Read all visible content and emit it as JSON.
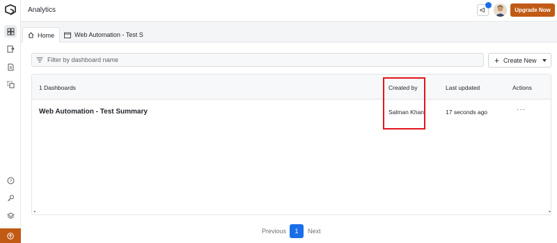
{
  "header": {
    "title": "Analytics",
    "upgrade_label": "Upgrade Now"
  },
  "tabs": [
    {
      "label": "Home",
      "icon": "home-icon",
      "active": true
    },
    {
      "label": "Web Automation - Test S",
      "icon": "calendar-icon",
      "active": false
    }
  ],
  "filter": {
    "placeholder": "Filter by dashboard name",
    "value": ""
  },
  "create_new": {
    "label": "Create New"
  },
  "table": {
    "count_label": "1 Dashboards",
    "columns": [
      "Created by",
      "Last updated",
      "Actions"
    ],
    "rows": [
      {
        "name": "Web Automation - Test Summary",
        "created_by": "Salman Khan",
        "last_updated": "17 seconds ago",
        "actions": "···"
      }
    ]
  },
  "pagination": {
    "previous": "Previous",
    "current": "1",
    "next": "Next"
  },
  "colors": {
    "accent": "#1a6fe8",
    "brand": "#c05a14",
    "highlight": "#e3131d"
  }
}
